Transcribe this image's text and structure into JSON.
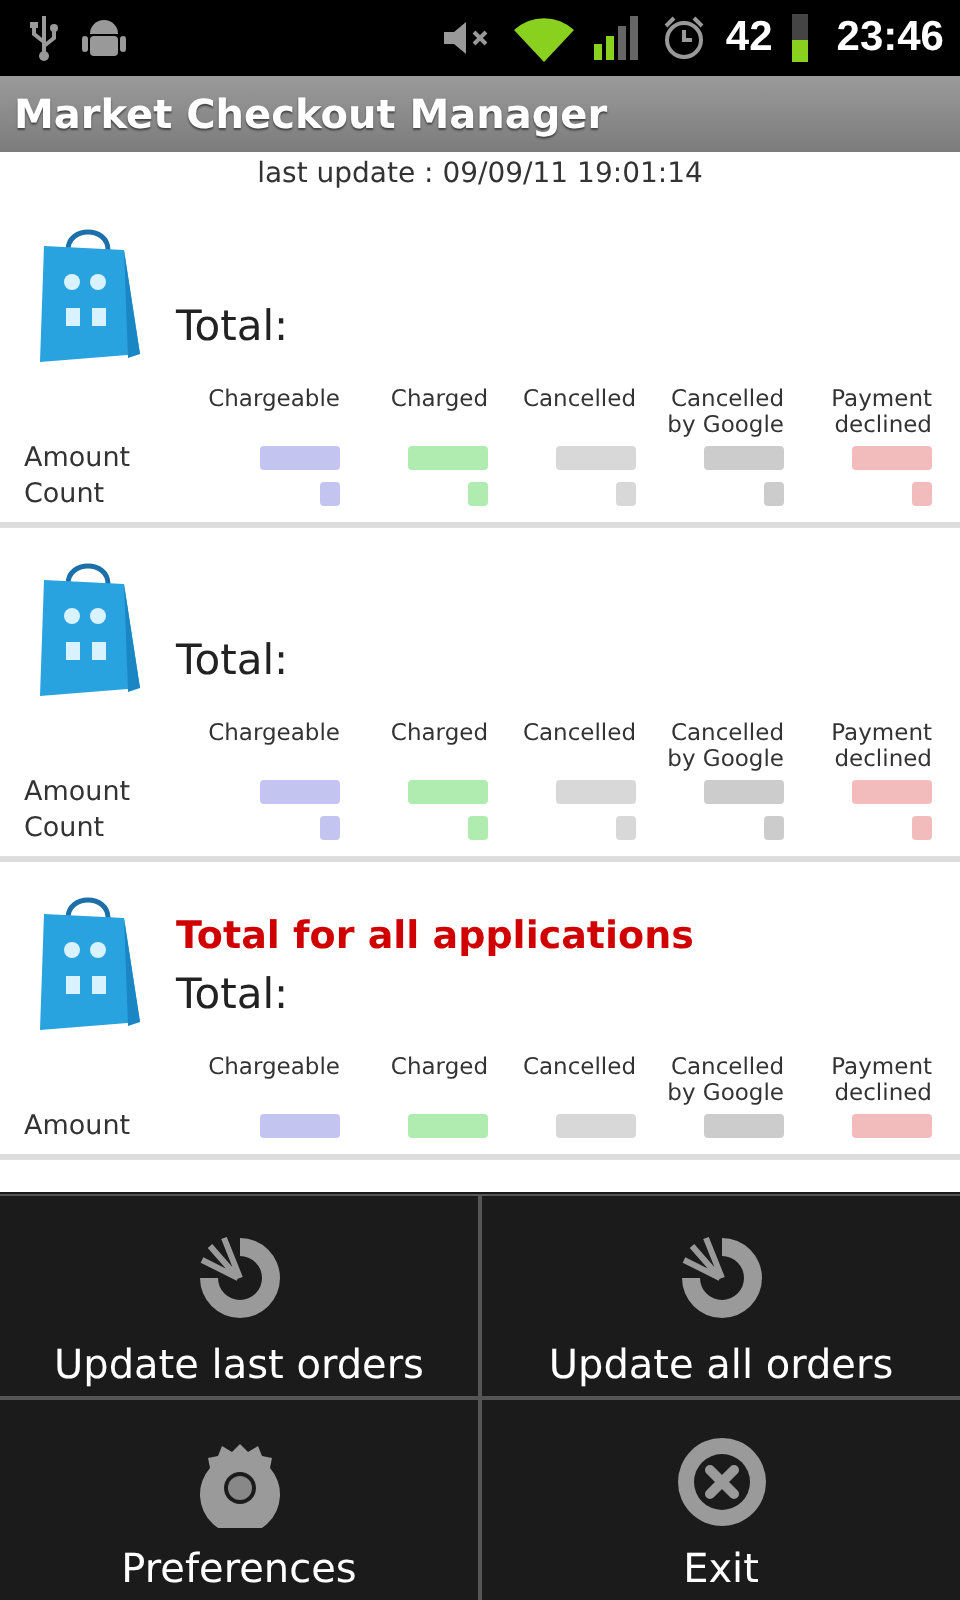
{
  "status_bar": {
    "battery_text": "42",
    "time": "23:46"
  },
  "window": {
    "title": "Market Checkout Manager"
  },
  "last_update": "last update : 09/09/11 19:01:14",
  "sections": [
    {
      "total_label": "Total:",
      "columns": [
        {
          "label": "Chargeable",
          "color": "#c4c4f0"
        },
        {
          "label": "Charged",
          "color": "#b0ecb0"
        },
        {
          "label": "Cancelled",
          "color": "#d8d8d8"
        },
        {
          "label": "Cancelled by Google",
          "color": "#cccccc"
        },
        {
          "label": "Payment declined",
          "color": "#f2bcbc"
        }
      ],
      "rows": [
        {
          "label": "Amount"
        },
        {
          "label": "Count"
        }
      ]
    },
    {
      "total_label": "Total:",
      "columns": [
        {
          "label": "Chargeable",
          "color": "#c4c4f0"
        },
        {
          "label": "Charged",
          "color": "#b0ecb0"
        },
        {
          "label": "Cancelled",
          "color": "#d8d8d8"
        },
        {
          "label": "Cancelled by Google",
          "color": "#cccccc"
        },
        {
          "label": "Payment declined",
          "color": "#f2bcbc"
        }
      ],
      "rows": [
        {
          "label": "Amount"
        },
        {
          "label": "Count"
        }
      ]
    },
    {
      "title": "Total for all applications",
      "total_label": "Total:",
      "columns": [
        {
          "label": "Chargeable",
          "color": "#c4c4f0"
        },
        {
          "label": "Charged",
          "color": "#b0ecb0"
        },
        {
          "label": "Cancelled",
          "color": "#d8d8d8"
        },
        {
          "label": "Cancelled by Google",
          "color": "#cccccc"
        },
        {
          "label": "Payment declined",
          "color": "#f2bcbc"
        }
      ],
      "rows": [
        {
          "label": "Amount"
        }
      ]
    }
  ],
  "menu": [
    {
      "label": "Update last orders",
      "kind": "refresh"
    },
    {
      "label": "Update all orders",
      "kind": "refresh"
    },
    {
      "label": "Preferences",
      "kind": "gear"
    },
    {
      "label": "Exit",
      "kind": "close"
    }
  ]
}
